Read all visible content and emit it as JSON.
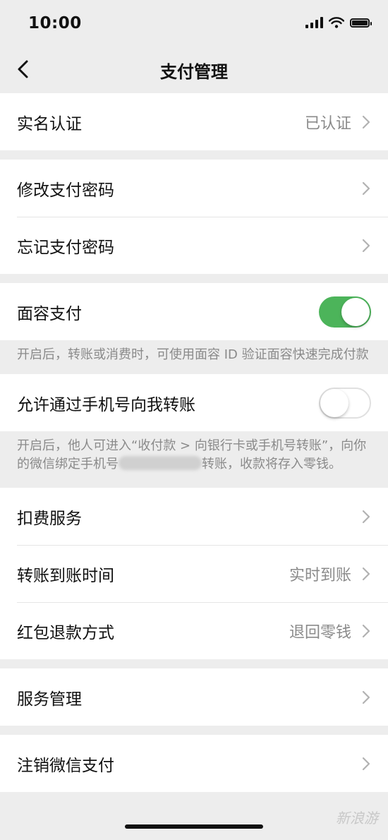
{
  "status_bar": {
    "time": "10:00"
  },
  "nav": {
    "title": "支付管理"
  },
  "groups": {
    "verify": {
      "label": "实名认证",
      "value": "已认证"
    },
    "password": {
      "change_label": "修改支付密码",
      "forgot_label": "忘记支付密码"
    },
    "face_pay": {
      "label": "面容支付",
      "enabled": true,
      "hint": "开启后，转账或消费时，可使用面容 ID 验证面容快速完成付款"
    },
    "phone_transfer": {
      "label": "允许通过手机号向我转账",
      "enabled": false,
      "hint_part1": "开启后，他人可进入“收付款 > 向银行卡或手机号转账”，向你的微信绑定手机号",
      "hint_part2": "转账，收款将存入零钱。"
    },
    "services": {
      "deduction_label": "扣费服务",
      "transfer_time_label": "转账到账时间",
      "transfer_time_value": "实时到账",
      "red_packet_label": "红包退款方式",
      "red_packet_value": "退回零钱"
    },
    "manage": {
      "label": "服务管理"
    },
    "cancel": {
      "label": "注销微信支付"
    }
  },
  "watermark": "新浪游",
  "colors": {
    "accent_green": "#4cb45a",
    "background": "#ededed",
    "secondary_text": "#8a8a8a"
  },
  "icons": [
    "back-arrow-icon",
    "chevron-right-icon",
    "signal-icon",
    "wifi-icon",
    "battery-icon"
  ]
}
